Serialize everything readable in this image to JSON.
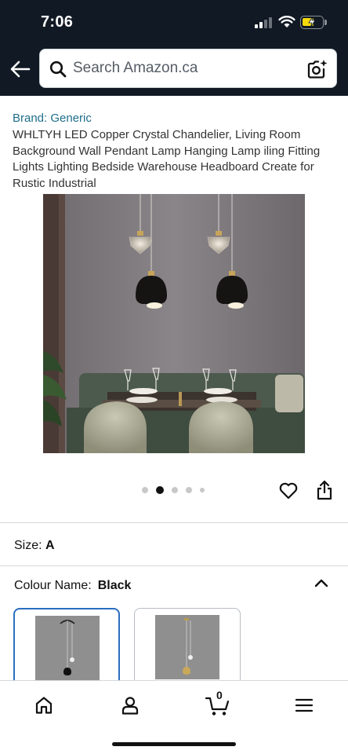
{
  "status_bar": {
    "time": "7:06"
  },
  "header": {
    "search": {
      "placeholder": "Search Amazon.ca"
    }
  },
  "product": {
    "brand": "Brand: Generic",
    "title": "WHLTYH LED Copper Crystal Chandelier, Living Room Background Wall Pendant Lamp Hanging Lamp iling Fitting Lights Lighting Bedside Warehouse Headboard Create for Rustic Industrial",
    "image_alt": "Two pendant lamps with crystal tops and black shades over a dining table",
    "image_count": 5,
    "current_image": 2
  },
  "size": {
    "label": "Size:",
    "value": "A"
  },
  "colour": {
    "label": "Colour Name:",
    "value": "Black",
    "options": [
      {
        "name": "Black",
        "selected": true
      },
      {
        "name": "Gold",
        "selected": false
      }
    ]
  },
  "bottom_nav": {
    "cart_count": "0",
    "items": [
      "home",
      "account",
      "cart",
      "menu"
    ]
  },
  "colors": {
    "header_bg": "#111a24",
    "link": "#1f6f8b",
    "selected_border": "#2a6ebf",
    "battery": "#f5d90a"
  }
}
